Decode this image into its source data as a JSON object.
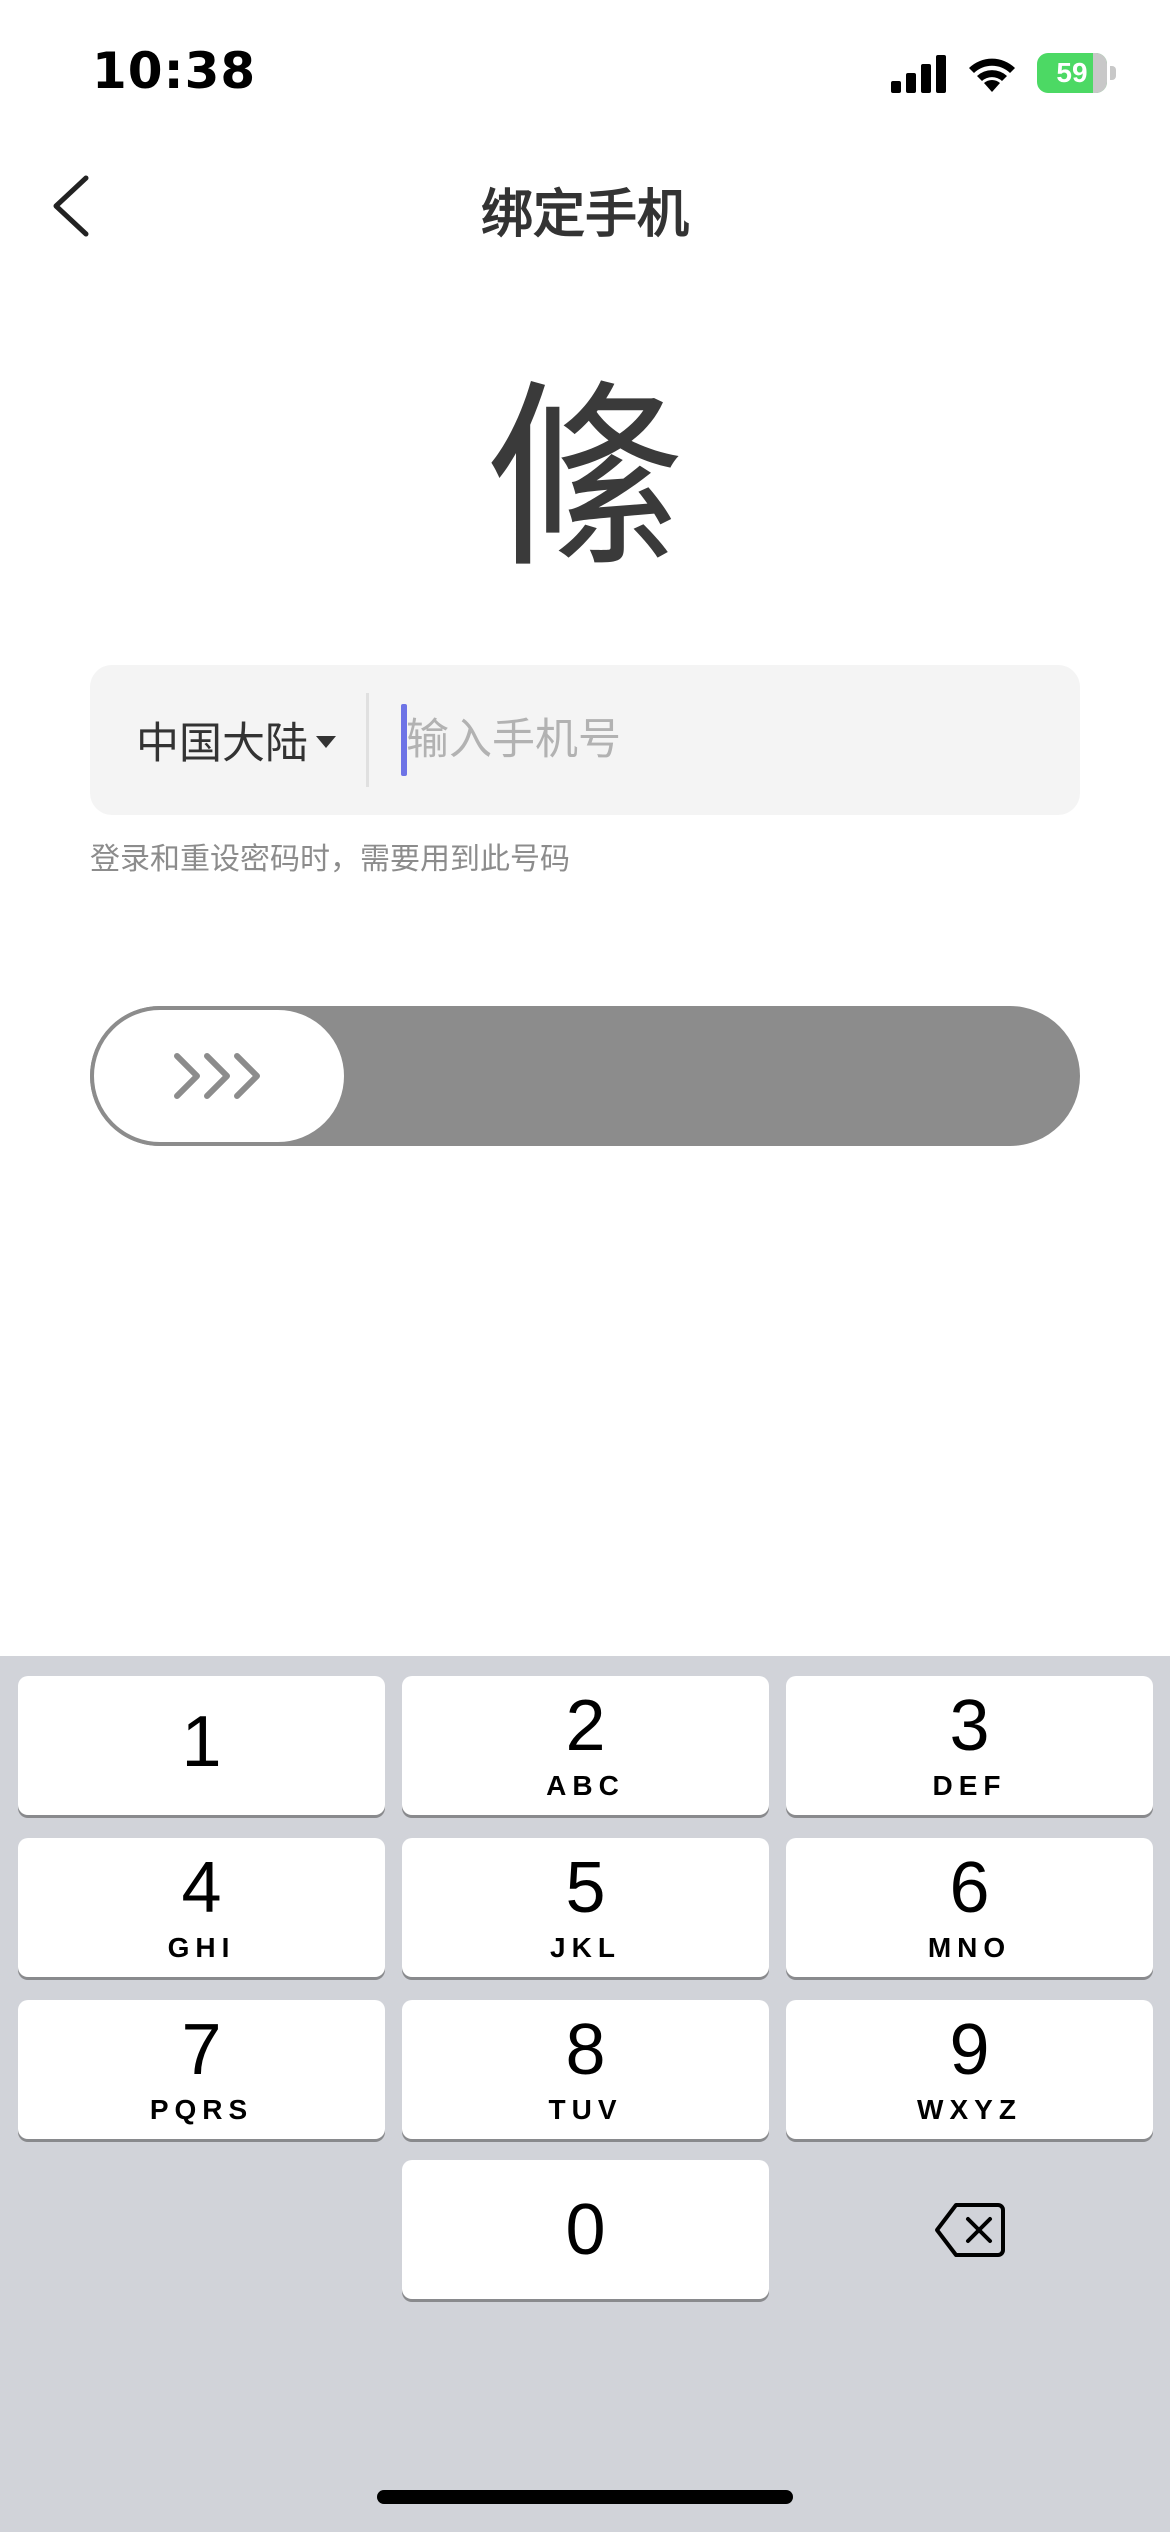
{
  "status_bar": {
    "time": "10:38",
    "battery": "59",
    "icons": [
      "signal-icon",
      "wifi-icon",
      "battery-charging-icon"
    ]
  },
  "nav": {
    "title": "绑定手机",
    "back_icon": "chevron-left-icon"
  },
  "logo": {
    "glyph": "絛"
  },
  "phone_form": {
    "region": "中国大陆",
    "region_icon": "caret-down-icon",
    "placeholder": "输入手机号",
    "value": "",
    "hint": "登录和重设密码时，需要用到此号码"
  },
  "slider": {
    "icon": "chevrons-right-icon",
    "progress": 0,
    "colors": {
      "track": "#8c8c8c",
      "thumb": "#ffffff"
    }
  },
  "keyboard": {
    "keys": [
      {
        "digit": "1",
        "letters": ""
      },
      {
        "digit": "2",
        "letters": "ABC"
      },
      {
        "digit": "3",
        "letters": "DEF"
      },
      {
        "digit": "4",
        "letters": "GHI"
      },
      {
        "digit": "5",
        "letters": "JKL"
      },
      {
        "digit": "6",
        "letters": "MNO"
      },
      {
        "digit": "7",
        "letters": "PQRS"
      },
      {
        "digit": "8",
        "letters": "TUV"
      },
      {
        "digit": "9",
        "letters": "WXYZ"
      },
      {
        "digit": "0",
        "letters": ""
      }
    ],
    "delete_icon": "backspace-icon"
  }
}
